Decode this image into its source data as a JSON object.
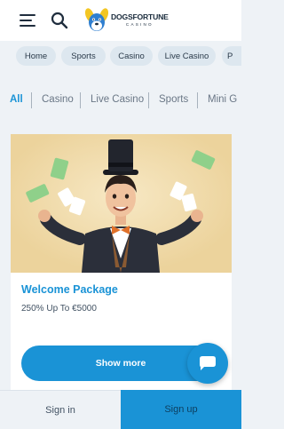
{
  "header": {
    "logo": {
      "name": "DOGSFORTUNE",
      "tagline": "CASINO"
    }
  },
  "quick_nav": [
    "Home",
    "Sports",
    "Casino",
    "Live Casino",
    "P"
  ],
  "tabs": [
    "All",
    "Casino",
    "Live Casino",
    "Sports",
    "Mini G"
  ],
  "active_tab": "All",
  "promo": {
    "title": "Welcome Package",
    "subtitle": "250% Up To €5000",
    "button": "Show more"
  },
  "bottom_bar": {
    "signin": "Sign in",
    "signup": "Sign up"
  },
  "colors": {
    "accent": "#1a93d6",
    "background": "#eef2f6",
    "pill": "#dde7ef",
    "promo_image_bg": "#f1ddb0"
  },
  "icons": [
    "menu-icon",
    "search-icon",
    "chat-icon"
  ]
}
